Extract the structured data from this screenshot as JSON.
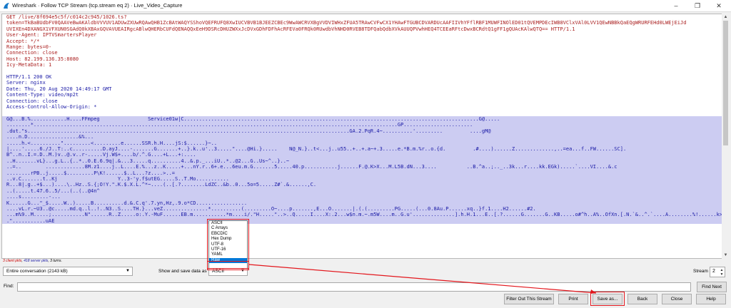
{
  "window": {
    "title": "Wireshark · Follow TCP Stream (tcp.stream eq 2) · Live_Video_Capture"
  },
  "stream_text": {
    "request": [
      "GET /live/8f694e5c5f/c014c2c945/1026.ts?",
      "token=TkBaBUdbFV0QAAVeBwAKAldbVVVUV1ADUwZXUwRQAwQHB1ZcBAtWAQYSShoVQEFRUFQ8XwIUCVBVB1BJEEZCBEc9WwAWCRVXBgVVDVIWHxZFUA5TRAwCVFwCX1YHAwFTGUBCDVARDUcAAFIIVhYFflRBF1MUWFINOlED01tQVEMPDEcIWB8VClxVAl0LVV1QEwNBBkQaEQgWRURFEHd0LWEjEiJd",
      "UVIXEn4DXANGX1VFXUN0SGAdQ0kXBAxGQVAVUEAIRgcABlwQHERbCUFdQENAQQxEeH9DSRcDHUZWXxJcDVxGDhFDFhAcRFEVa0FRQk0RUwdbVhNHD0RVEB8TDFQabQdbXVkAUUQPVwhHEQ4TCEEaRFtcDwxBCRdtQ1gFF1gQUAcKAlwQTQ== HTTP/1.1",
      "User-Agent: IPTVSmartersPlayer",
      "Accept: */*",
      "Range: bytes=0-",
      "Connection: close",
      "Host: 82.199.136.35:8080",
      "Icy-MetaData: 1"
    ],
    "response": [
      "HTTP/1.1 200 OK",
      "Server: nginx",
      "Date: Thu, 20 Aug 2020 14:49:17 GMT",
      "Content-Type: video/mp2t",
      "Connection: close",
      "Access-Control-Allow-Origin: *"
    ],
    "data": [
      "G@...B.%............H....FFmpeg                Service01w|C..................................................................................................G@.....",
      "........*.........................................................................................................................GP.......................",
      ".dut.\"s...........................................................................................................GA.2.PqR.4~..........'.........         ....gM@",
      "....n.D.................&%...",
      ".....h.<..........\".........<.........e......SSR.h.H....jS:$......}~..",
      "|....'.....6./J..T:..c..........D.ayJ....-.......G.......+..}.k..u'..3.....\"....@Hi.}.....    N@_N.}..t<...j..u55..+..+.a~+.3.....e.*B.m.%r..o.{d.         .#....)......Z.............,..=ea...f..FW......SC].",
      "B^..n..I.=.D..M.)v..@.v..r-.....Vj.W$+....b/.^.G....+L...+:....",
      "..H.......vL}...g.L..{..*..0.E.6.9q|.&...3.....q..........4..&.p._...iU..*..@2...G..Us~^..}..~",
      "..=..        .............8M.z1....j..L....E.%...z..K.....+...nY.r..6+.e...6eu.m.G.......5.....40.p...........j......F.@.K>X...M.L5B.dN...3....          ..B.^a..;.._..3k...r....kk.EGk).....`....VI....&.c",
      "........rPB..j.....$.........P\\K!......$..L...?z....>..=",
      "..v.C.......t..Kj                    Y..3-'y.f$utEG.....S..T.Mo...........",
      "R...8|.g..+$...)....\\..Hz..S.{;O!Y.\".K.$.X.L.^*~....(..[.?........LdZC..&b..0...5o=5.....Z#`.&......,C.",
      "..(.....t.47.6..5/...(..(..@4n^",
      "....s.........-...",
      "K......G...\"_$.....W..).....B..........d.&.C.q'.7.yn,Hz,.9.o*CD.................",
      "....vL.r.~U3..@c.....md.q..l..!..N3..S....TH.}...veZ...............*..........(.........O~....p.......,E...O.......|.(.(.........PG.....(...0.8Au.P......xq..}f.1....H2......#2.",
      "...m%9..M.....;...........N\"......R..Z.....o:.Y.-MuF......EB.m...........*m....i/.\"H.....\"..>..Q.....I....X:.2...w$n.m.~.m5W....m..G.u'..............].h.H.1...E..[.?......G.......G..KB.....o#^h..A%..OfXn.[.N.`&..^.`....A........%!......k>.",
      ".\"...........uAE"
    ]
  },
  "stats": {
    "client": "3 client pkts",
    "server": "418 server pkts",
    "turns": "3 turns."
  },
  "controls": {
    "conversation": "Entire conversation (2143 kB)",
    "show_save_label": "Show and save data as",
    "show_save_value": "ASCII",
    "stream_label": "Stream",
    "stream_value": "2",
    "find_label": "Find:",
    "find_value": ""
  },
  "encoding_options": [
    "ASCII",
    "C Arrays",
    "EBCDIC",
    "Hex Dump",
    "UTF-8",
    "UTF-16",
    "YAML",
    "Raw"
  ],
  "buttons": {
    "find_next": "Find Next",
    "filter_out": "Filter Out This Stream",
    "print": "Print",
    "save_as": "Save as...",
    "back": "Back",
    "close": "Close",
    "help": "Help"
  },
  "colors": {
    "client_text": "#aa1f1f",
    "server_text": "#1a1aa6",
    "server_highlight": "#ccccf2",
    "annotation": "#e3161c",
    "selection": "#0078d7"
  }
}
